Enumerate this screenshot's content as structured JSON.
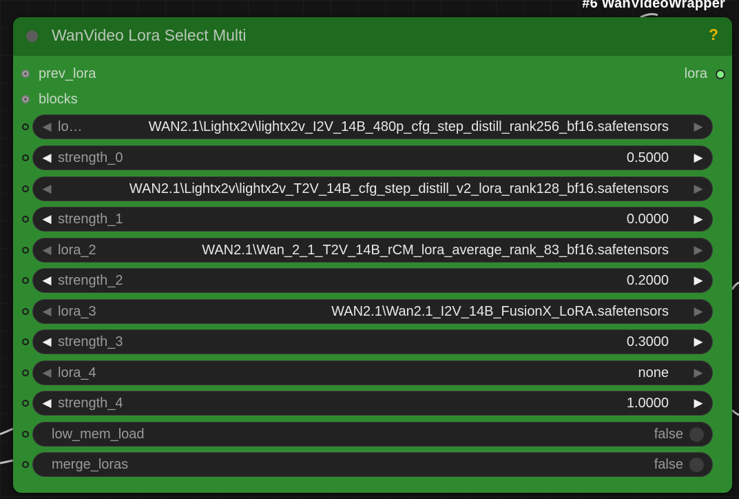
{
  "background_node": {
    "title": "#6 WanVideoWrapper"
  },
  "node": {
    "title": "WanVideo Lora Select Multi",
    "help": "?",
    "inputs": [
      {
        "label": "prev_lora"
      },
      {
        "label": "blocks"
      }
    ],
    "output": {
      "label": "lora"
    },
    "widgets": [
      {
        "kind": "combo",
        "label": "lo…",
        "value": "WAN2.1\\Lightx2v\\lightx2v_I2V_14B_480p_cfg_step_distill_rank256_bf16.safetensors"
      },
      {
        "kind": "number",
        "label": "strength_0",
        "value": "0.5000"
      },
      {
        "kind": "combo",
        "label": "",
        "value": "WAN2.1\\Lightx2v\\lightx2v_T2V_14B_cfg_step_distill_v2_lora_rank128_bf16.safetensors"
      },
      {
        "kind": "number",
        "label": "strength_1",
        "value": "0.0000"
      },
      {
        "kind": "combo",
        "label": "lora_2",
        "value": "WAN2.1\\Wan_2_1_T2V_14B_rCM_lora_average_rank_83_bf16.safetensors"
      },
      {
        "kind": "number",
        "label": "strength_2",
        "value": "0.2000"
      },
      {
        "kind": "combo",
        "label": "lora_3",
        "value": "WAN2.1\\Wan2.1_I2V_14B_FusionX_LoRA.safetensors"
      },
      {
        "kind": "number",
        "label": "strength_3",
        "value": "0.3000"
      },
      {
        "kind": "combo",
        "label": "lora_4",
        "value": "none"
      },
      {
        "kind": "number",
        "label": "strength_4",
        "value": "1.0000"
      },
      {
        "kind": "toggle",
        "label": "low_mem_load",
        "value": "false"
      },
      {
        "kind": "toggle",
        "label": "merge_loras",
        "value": "false"
      }
    ]
  },
  "colors": {
    "node_body": "#2f8a2f",
    "node_header": "#1e6a1e",
    "widget_bg": "#222222",
    "output_slot": "#7ef07e",
    "help": "#e6b400"
  },
  "icons": {
    "combo_left": "left-triangle-icon",
    "combo_right": "right-triangle-icon"
  }
}
